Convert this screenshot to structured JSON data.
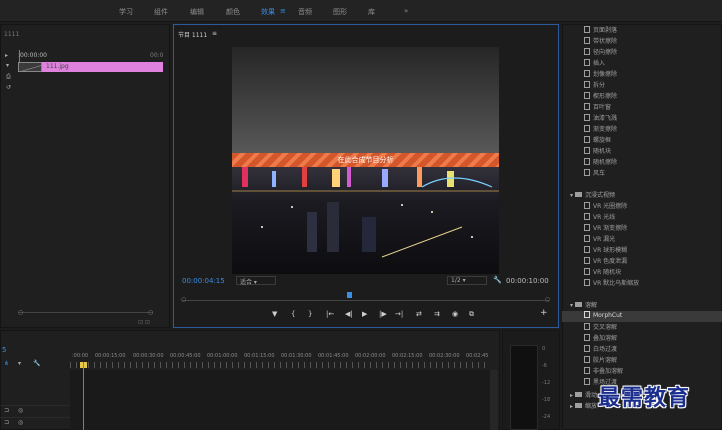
{
  "workspaces": [
    "学习",
    "组件",
    "编辑",
    "颜色",
    "效果",
    "音频",
    "图形",
    "库"
  ],
  "workspace_menu_icon": "≡",
  "workspace_overflow": "»",
  "source": {
    "panel_tab": "1111",
    "timecode_start": ":00:00:00",
    "timecode_end": "00:0",
    "clip_name": "111.jpg"
  },
  "program": {
    "title": "节目 1111",
    "menu_icon": "≡",
    "overlay_text": "在此合成节目分析",
    "timecode_current": "00:00:04:15",
    "timecode_duration": "00:00:10:00",
    "fit_value": "适合",
    "quality_value": "1/2",
    "controls": [
      "▼",
      "{",
      "}",
      "|←",
      "◀|",
      "▶",
      "|▶",
      "→|",
      "⇄",
      "⇉",
      "◉",
      "⧉",
      "+"
    ]
  },
  "effects": {
    "items_top": [
      "页面剥落",
      "带状擦除",
      "径向擦除",
      "插入",
      "划像擦除",
      "拆分",
      "楔形擦除",
      "百叶窗",
      "油漆飞溅",
      "渐变擦除",
      "螺旋框",
      "随机块",
      "随机擦除",
      "风车"
    ],
    "folder_immersive": "沉浸式视频",
    "items_vr": [
      "VR 光圈擦除",
      "VR 光线",
      "VR 渐变擦除",
      "VR 漏光",
      "VR 球形模糊",
      "VR 色度泄漏",
      "VR 随机块",
      "VR 默比乌斯缩放"
    ],
    "folder_dissolve": "溶解",
    "items_dissolve": [
      "MorphCut",
      "交叉溶解",
      "叠加溶解",
      "白场过渡",
      "胶片溶解",
      "非叠加溶解",
      "黑场过渡"
    ],
    "selected_item": "MorphCut",
    "folder_slide": "滑动",
    "folder_zoom": "缩放"
  },
  "timeline": {
    "timecode": "5",
    "ruler_labels": [
      ":00:00",
      "00:00:15:00",
      "00:00:30:00",
      "00:00:45:00",
      "00:01:00:00",
      "00:01:15:00",
      "00:01:30:00",
      "00:01:45:00",
      "00:02:00:00",
      "00:02:15:00",
      "00:02:30:00",
      "00:02:45"
    ]
  },
  "meter": {
    "db_labels": [
      "0",
      "-6",
      "-12",
      "-18",
      "-24"
    ]
  },
  "watermark": "最需教育"
}
